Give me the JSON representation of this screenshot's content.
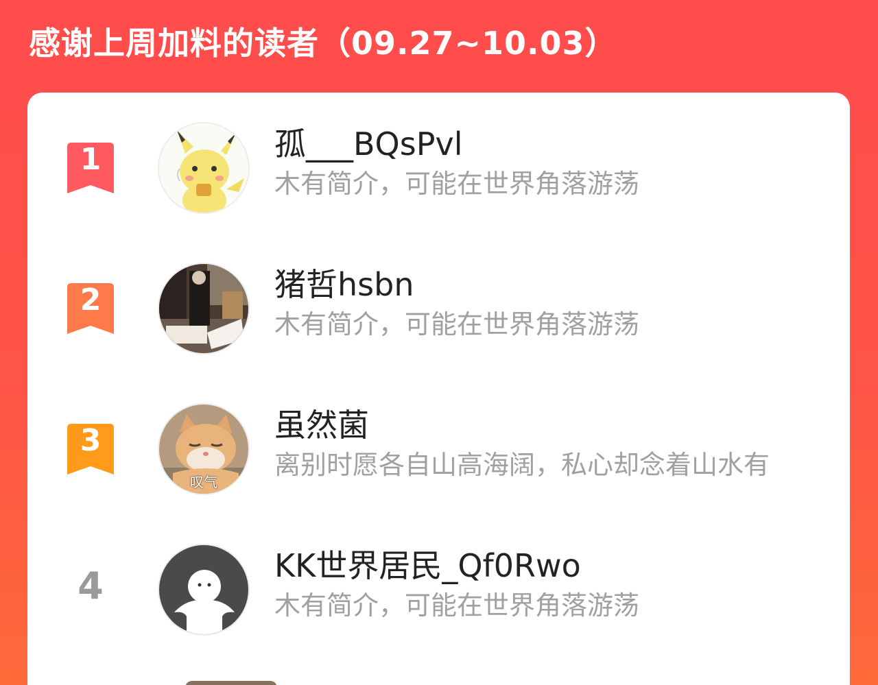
{
  "header": {
    "title": "感谢上周加料的读者（09.27~10.03）"
  },
  "colors": {
    "background_top": "#ff4c4c",
    "background_bottom": "#ff6a3a",
    "rank1_flag": "#ff5a5f",
    "rank2_flag": "#ff7a4a",
    "rank3_flag": "#ff9a1a",
    "rank_plain": "#9a9a9a"
  },
  "readers": [
    {
      "rank": "1",
      "name": "孤___BQsPvl",
      "bio": "木有简介，可能在世界角落游荡",
      "avatar_icon": "pikachu-avatar"
    },
    {
      "rank": "2",
      "name": "猪哲hsbn",
      "bio": "木有简介，可能在世界角落游荡",
      "avatar_icon": "photo-avatar"
    },
    {
      "rank": "3",
      "name": "虽然菌",
      "bio": "离别时愿各自山高海阔，私心却念着山水有",
      "avatar_icon": "cat-avatar",
      "avatar_caption": "叹气"
    },
    {
      "rank": "4",
      "name": "KK世界居民_Qf0Rwo",
      "bio": "木有简介，可能在世界角落游荡",
      "avatar_icon": "default-user-avatar"
    }
  ]
}
